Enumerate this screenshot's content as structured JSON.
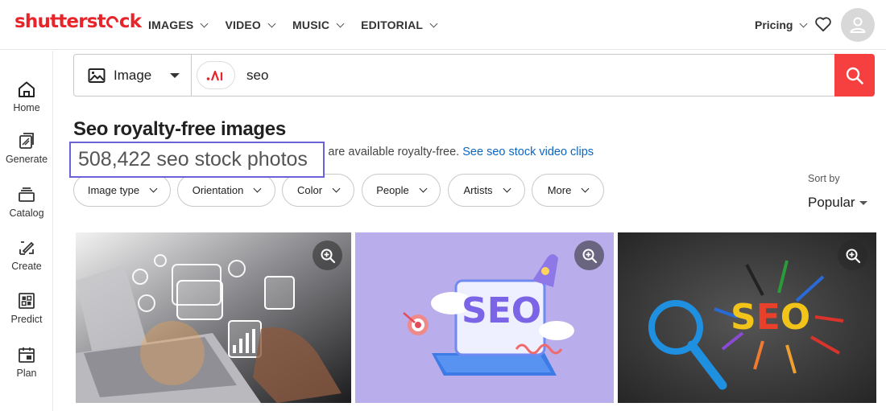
{
  "header": {
    "logo": "shutterstock",
    "nav": [
      {
        "label": "IMAGES"
      },
      {
        "label": "VIDEO"
      },
      {
        "label": "MUSIC"
      },
      {
        "label": "EDITORIAL"
      }
    ],
    "pricing_label": "Pricing"
  },
  "sidebar": {
    "items": [
      {
        "label": "Home",
        "icon": "home-icon"
      },
      {
        "label": "Generate",
        "icon": "generate-icon"
      },
      {
        "label": "Catalog",
        "icon": "catalog-icon"
      },
      {
        "label": "Create",
        "icon": "create-icon"
      },
      {
        "label": "Predict",
        "icon": "predict-icon"
      },
      {
        "label": "Plan",
        "icon": "plan-icon"
      }
    ]
  },
  "search": {
    "type_label": "Image",
    "query": "seo",
    "ai_icon": "ai-search-icon"
  },
  "results": {
    "title": "Seo royalty-free images",
    "count_text": "508,422 seo stock photos",
    "subline_visible": "ons are available royalty-free.",
    "video_link": "See seo stock video clips"
  },
  "filters": [
    {
      "label": "Image type"
    },
    {
      "label": "Orientation"
    },
    {
      "label": "Color"
    },
    {
      "label": "People"
    },
    {
      "label": "Artists"
    },
    {
      "label": "More"
    }
  ],
  "sort": {
    "label": "Sort by",
    "value": "Popular"
  },
  "colors": {
    "brand": "#e8232a",
    "search_button": "#f5403f",
    "link": "#0a66c2",
    "highlight_border": "#6a62d6"
  }
}
